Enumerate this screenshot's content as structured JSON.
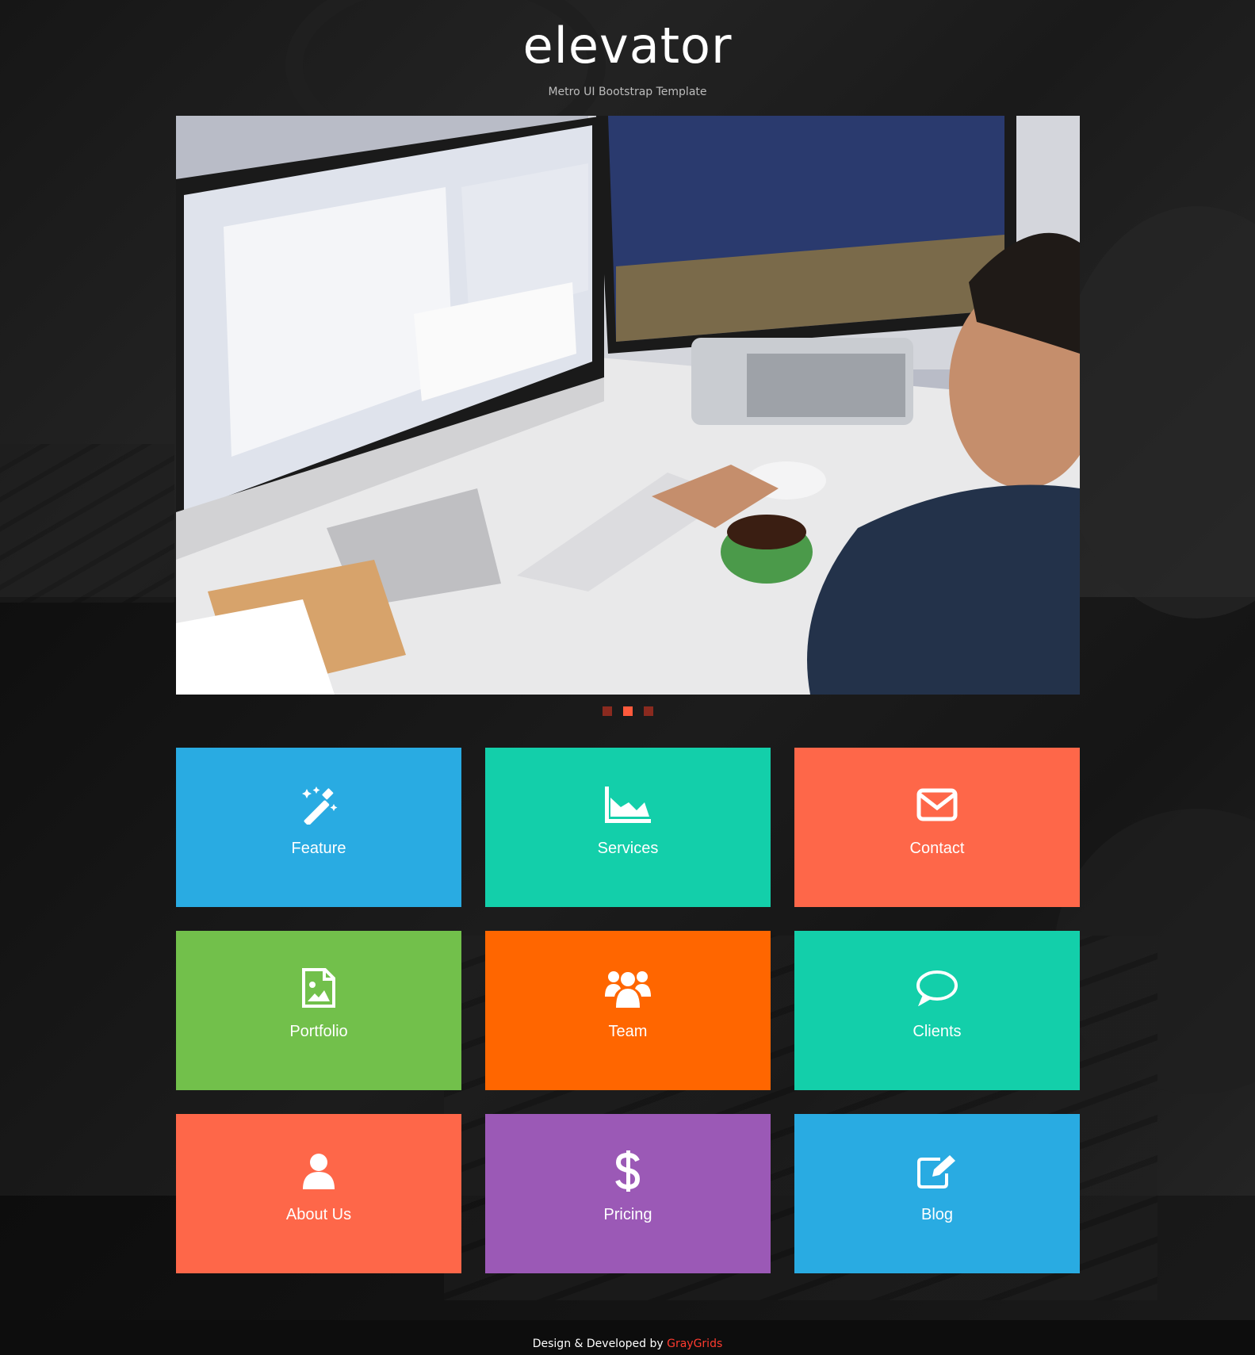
{
  "header": {
    "logo": "elevator",
    "tagline": "Metro UI Bootstrap Template"
  },
  "slider": {
    "image_description": "workspace-monitors-person-typing",
    "dots": [
      {
        "active": false
      },
      {
        "active": true
      },
      {
        "active": false
      }
    ]
  },
  "tiles": [
    {
      "label": "Feature",
      "icon": "magic-wand-icon",
      "color": "#29abe2"
    },
    {
      "label": "Services",
      "icon": "area-chart-icon",
      "color": "#13cfaa"
    },
    {
      "label": "Contact",
      "icon": "envelope-icon",
      "color": "#fe6749"
    },
    {
      "label": "Portfolio",
      "icon": "image-file-icon",
      "color": "#72c04b"
    },
    {
      "label": "Team",
      "icon": "users-icon",
      "color": "#ff6600"
    },
    {
      "label": "Clients",
      "icon": "comment-icon",
      "color": "#13cfaa"
    },
    {
      "label": "About Us",
      "icon": "user-icon",
      "color": "#fe6749"
    },
    {
      "label": "Pricing",
      "icon": "dollar-icon",
      "color": "#9b59b6"
    },
    {
      "label": "Blog",
      "icon": "edit-icon",
      "color": "#29abe2"
    }
  ],
  "footer": {
    "prefix": "Design & Developed by ",
    "link": "GrayGrids",
    "link_color": "#ff3b2f"
  }
}
